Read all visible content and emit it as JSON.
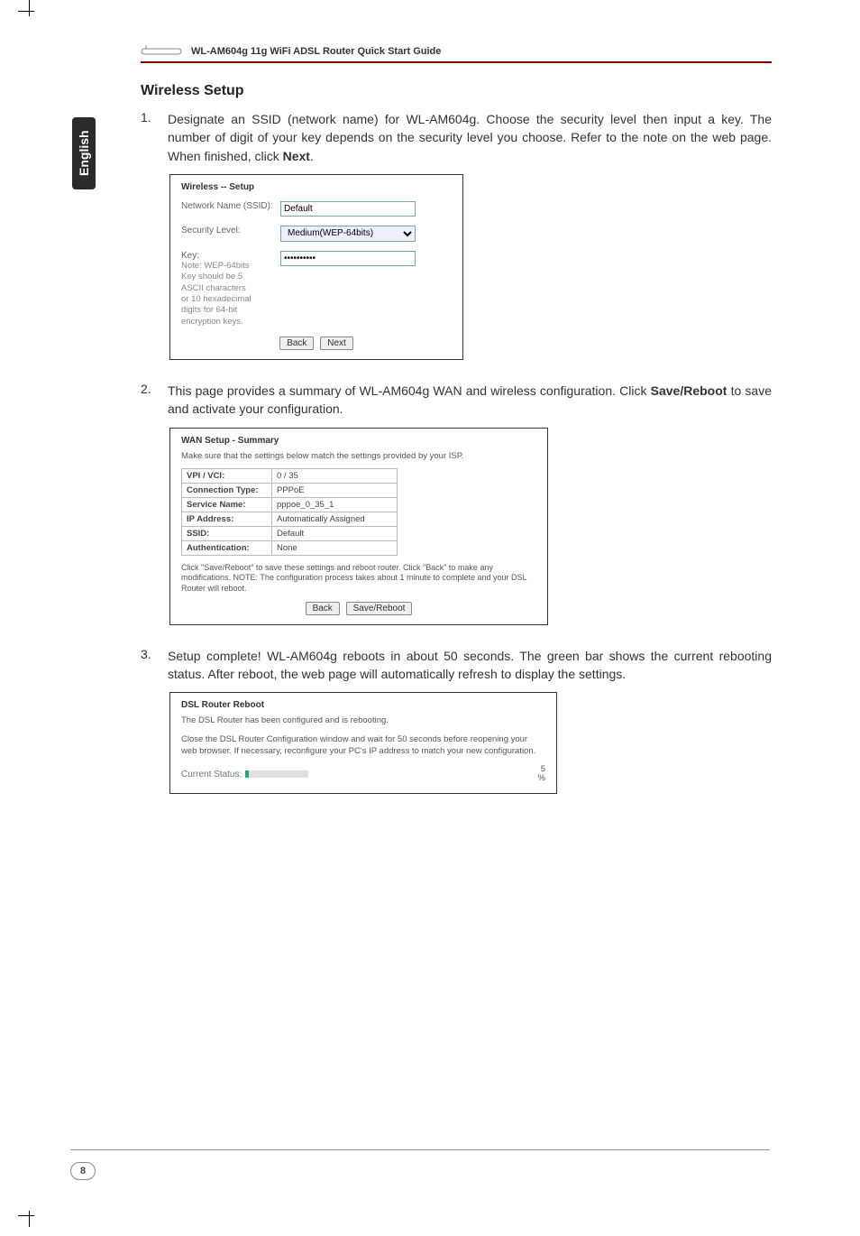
{
  "header": {
    "doc_title": "WL-AM604g 11g WiFi ADSL Router Quick Start Guide"
  },
  "side_tab": "English",
  "section_title": "Wireless Setup",
  "steps": {
    "s1": {
      "num": "1.",
      "text_a": "Designate an SSID (network name) for WL-AM604g. Choose the security level then input a key. The number of digit of your key depends on the security level you choose. Refer to the note on the web page. When finished, click ",
      "bold": "Next",
      "text_b": "."
    },
    "s2": {
      "num": "2.",
      "text_a": "This page provides a summary of WL-AM604g WAN and wireless configuration. Click ",
      "bold": "Save/Reboot",
      "text_b": " to save and activate your configuration."
    },
    "s3": {
      "num": "3.",
      "text_a": "Setup complete! WL-AM604g reboots in about 50 seconds. The green bar shows the current rebooting status. After reboot, the web page will automatically refresh to display the settings."
    }
  },
  "fig1": {
    "title": "Wireless -- Setup",
    "labels": {
      "ssid": "Network Name (SSID):",
      "sec": "Security Level:",
      "key": "Key:",
      "note": "Note: WEP-64bits Key should be 5 ASCII characters or 10 hexadecimal digits for 64-bit encryption keys."
    },
    "values": {
      "ssid": "Default",
      "sec": "Medium(WEP-64bits)",
      "key": "••••••••••"
    },
    "buttons": {
      "back": "Back",
      "next": "Next"
    }
  },
  "fig2": {
    "title": "WAN Setup - Summary",
    "sub": "Make sure that the settings below match the settings provided by your ISP.",
    "rows": [
      {
        "k": "VPI / VCI:",
        "v": "0 / 35"
      },
      {
        "k": "Connection Type:",
        "v": "PPPoE"
      },
      {
        "k": "Service Name:",
        "v": "pppoe_0_35_1"
      },
      {
        "k": "IP Address:",
        "v": "Automatically Assigned"
      },
      {
        "k": "SSID:",
        "v": "Default"
      },
      {
        "k": "Authentication:",
        "v": "None"
      }
    ],
    "note": "Click \"Save/Reboot\" to save these settings and reboot router. Click \"Back\" to make any modifications.\nNOTE: The configuration process takes about 1 minute to complete and your DSL Router will reboot.",
    "buttons": {
      "back": "Back",
      "save": "Save/Reboot"
    }
  },
  "fig3": {
    "title": "DSL Router Reboot",
    "p1": "The DSL Router has been configured and is rebooting.",
    "p2": "Close the DSL Router Configuration window and wait for 50 seconds before reopening your web browser. If necessary, reconfigure your PC's IP address to match your new configuration.",
    "status_label": "Current Status:",
    "pct_num": "5",
    "pct_sym": "%"
  },
  "page_number": "8"
}
